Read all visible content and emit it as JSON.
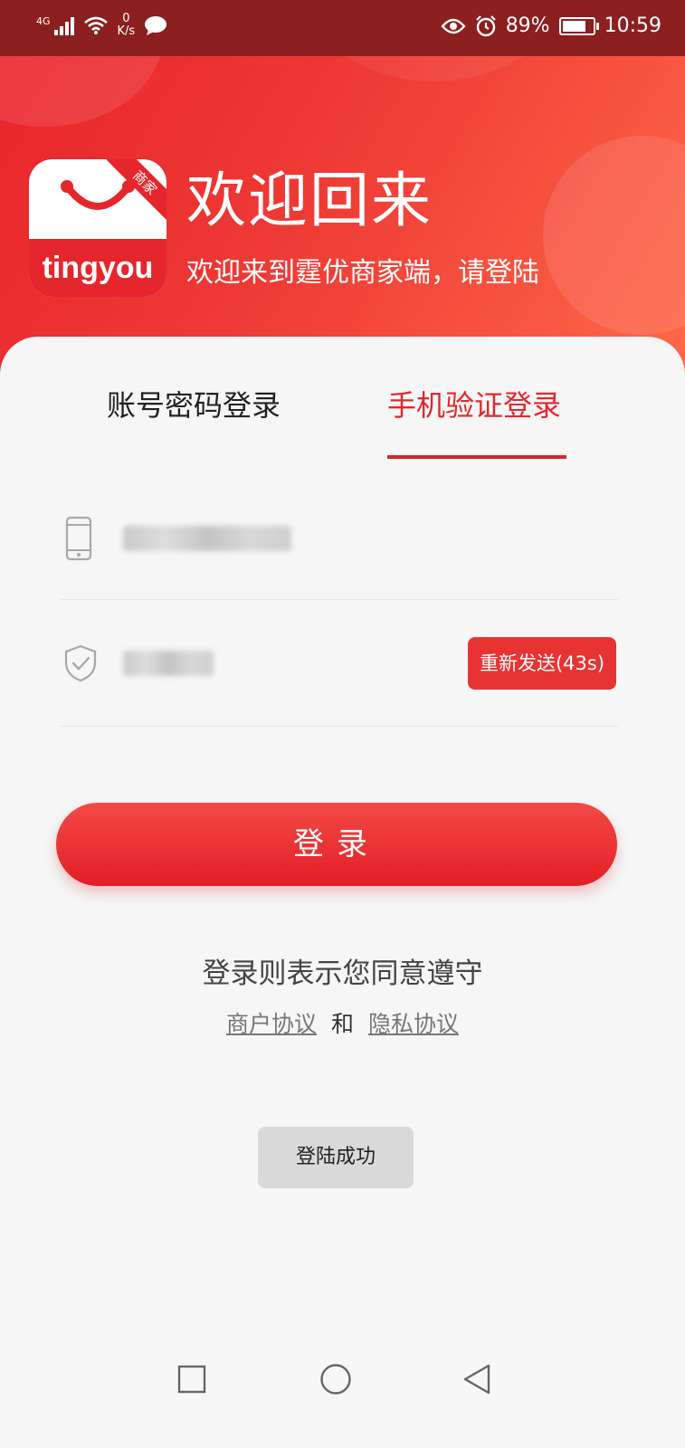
{
  "status_bar": {
    "network": "4G",
    "speed_value": "0",
    "speed_unit": "K/s",
    "battery": "89%",
    "battery_level": 0.89,
    "time": "10:59"
  },
  "header": {
    "app_icon_text": "tingyou",
    "app_icon_badge": "商家",
    "title": "欢迎回来",
    "subtitle": "欢迎来到霆优商家端，请登陆"
  },
  "tabs": [
    {
      "label": "账号密码登录",
      "active": false
    },
    {
      "label": "手机验证登录",
      "active": true
    }
  ],
  "form": {
    "resend_label": "重新发送(43s)",
    "login_label": "登录"
  },
  "agreement": {
    "text": "登录则表示您同意遵守",
    "merchant_link": "商户协议",
    "and": "和",
    "privacy_link": "隐私协议"
  },
  "toast": "登陆成功",
  "colors": {
    "brand_red": "#e5262c",
    "status_bar": "#8c1f1f"
  },
  "icons": [
    "phone-icon",
    "shield-check-icon",
    "square-recents-icon",
    "circle-home-icon",
    "triangle-back-icon"
  ]
}
